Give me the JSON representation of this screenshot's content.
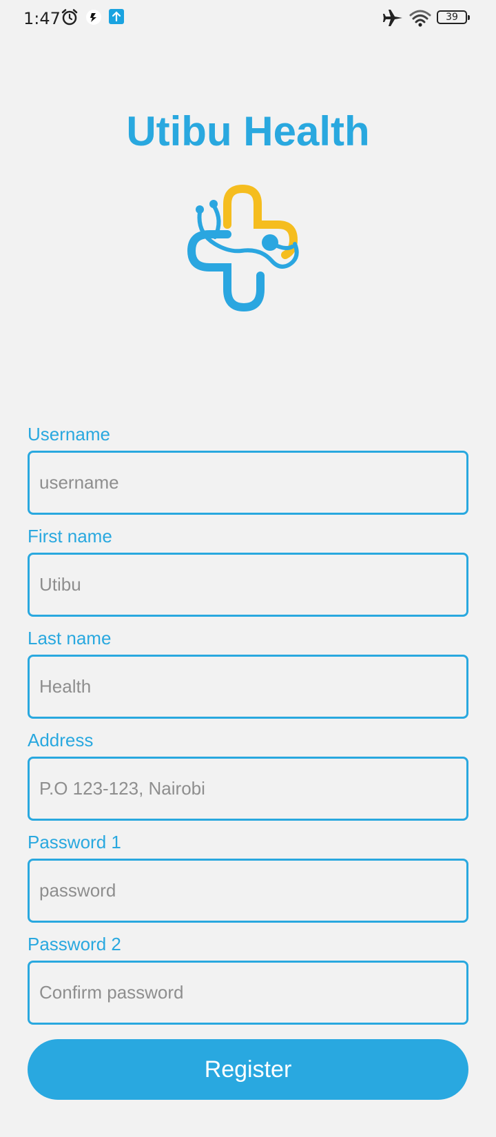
{
  "status_bar": {
    "time": "1:47",
    "battery_level": "39",
    "icons": [
      "alarm-icon",
      "app-notification-icon",
      "upload-icon",
      "airplane-mode-icon",
      "wifi-icon",
      "battery-icon"
    ]
  },
  "app": {
    "title": "Utibu Health",
    "logo": "medical-cross-stethoscope-logo",
    "brand_color": "#29a8df",
    "accent_color": "#f5bd1f"
  },
  "form": {
    "fields": [
      {
        "label": "Username",
        "placeholder": "username",
        "value": ""
      },
      {
        "label": "First name",
        "placeholder": "Utibu",
        "value": ""
      },
      {
        "label": "Last name",
        "placeholder": "Health",
        "value": ""
      },
      {
        "label": "Address",
        "placeholder": "P.O 123-123, Nairobi",
        "value": ""
      },
      {
        "label": "Password 1",
        "placeholder": "password",
        "value": ""
      },
      {
        "label": "Password 2",
        "placeholder": "Confirm password",
        "value": ""
      }
    ],
    "submit_label": "Register"
  }
}
